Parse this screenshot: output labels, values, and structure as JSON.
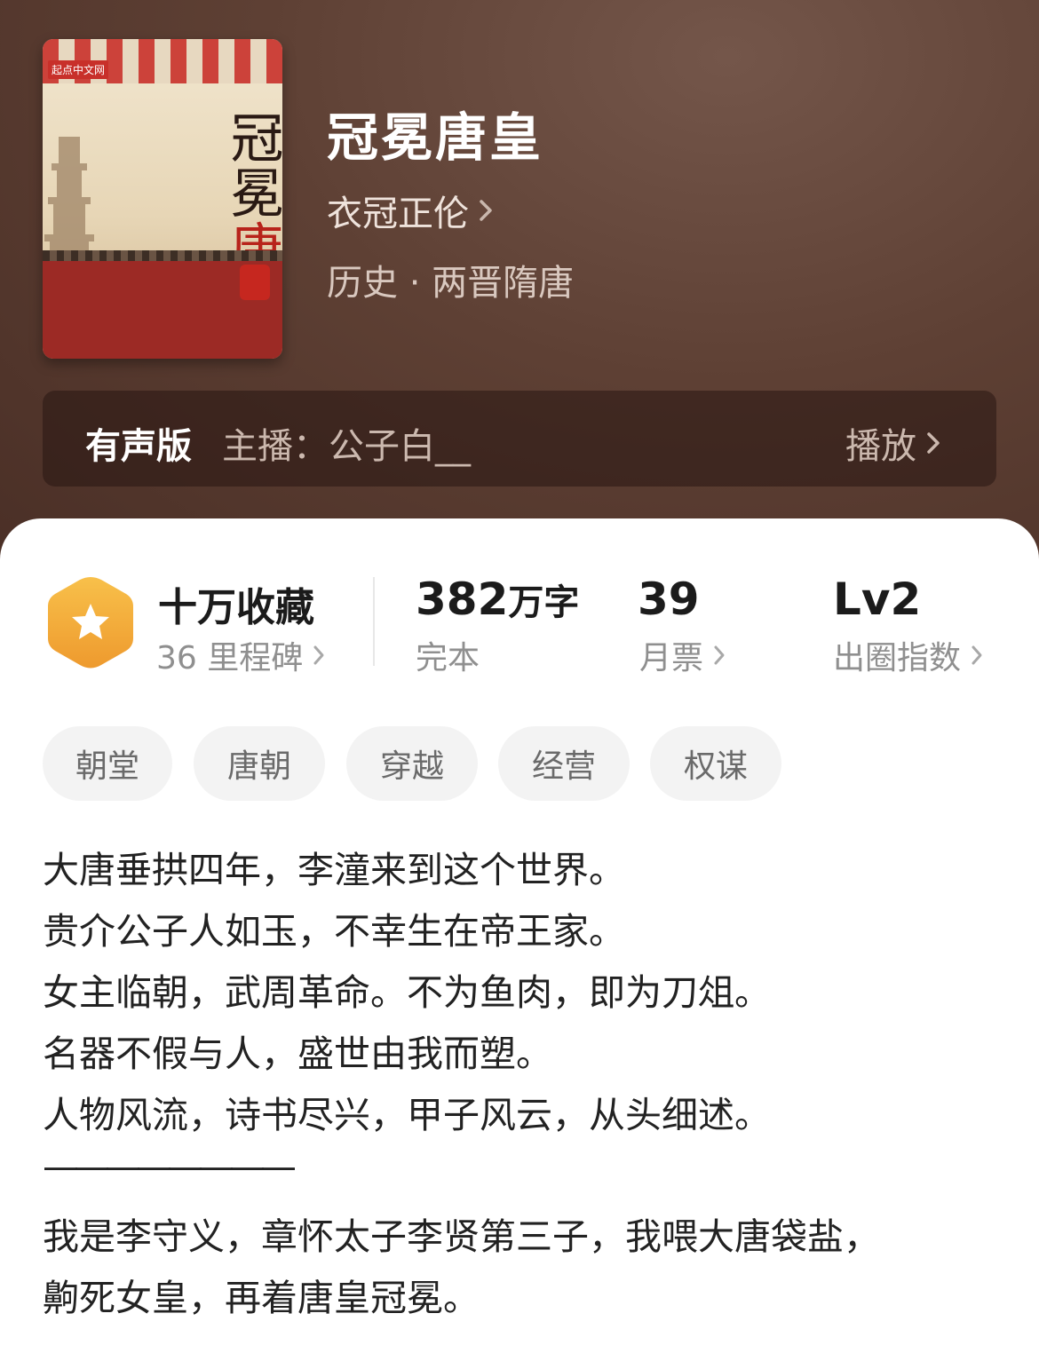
{
  "book": {
    "cover_brand": "起点中文网",
    "cover_title_black": "冠冕",
    "cover_title_red": "唐皇",
    "title": "冠冕唐皇",
    "author": "衣冠正伦",
    "category": "历史 · 两晋隋唐"
  },
  "audio": {
    "tag": "有声版",
    "host": "主播：公子白__",
    "play_label": "播放"
  },
  "stats": {
    "favorites": "十万收藏",
    "milestones": "36 里程碑",
    "word_count": "382",
    "word_unit": "万字",
    "status": "完本",
    "monthly_votes": "39",
    "monthly_votes_label": "月票",
    "level": "Lv2",
    "level_label": "出圈指数"
  },
  "tags": [
    "朝堂",
    "唐朝",
    "穿越",
    "经营",
    "权谋"
  ],
  "description": [
    "大唐垂拱四年，李潼来到这个世界。",
    "贵介公子人如玉，不幸生在帝王家。",
    "女主临朝，武周革命。不为鱼肉，即为刀俎。",
    "名器不假与人，盛世由我而塑。",
    "人物风流，诗书尽兴，甲子风云，从头细述。",
    "————————",
    "我是李守义，章怀太子李贤第三子，我喂大唐袋盐，",
    "齁死女皇，再着唐皇冠冕。"
  ],
  "colors": {
    "header_bg": "#5e4034",
    "badge": "#f2a93b",
    "accent_red": "#b8231b"
  },
  "icons": [
    "chevron-right-icon",
    "star-badge-icon"
  ]
}
